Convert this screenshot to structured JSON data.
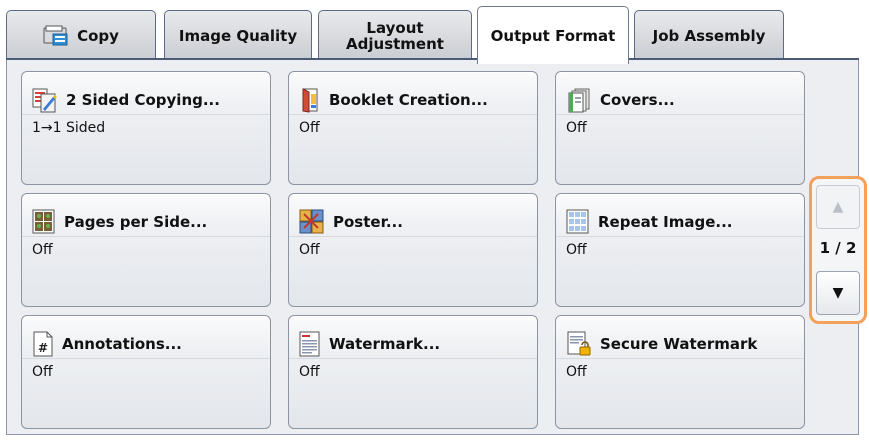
{
  "tabs": [
    {
      "label": "Copy",
      "icon": "copy-icon",
      "active": false
    },
    {
      "label": "Image Quality",
      "active": false
    },
    {
      "label": "Layout\nAdjustment",
      "active": false
    },
    {
      "label": "Output Format",
      "active": true
    },
    {
      "label": "Job Assembly",
      "active": false
    }
  ],
  "buttons": [
    {
      "title": "2 Sided Copying...",
      "value": "1→1 Sided",
      "icon": "two-sided-copying-icon"
    },
    {
      "title": "Booklet Creation...",
      "value": "Off",
      "icon": "booklet-icon"
    },
    {
      "title": "Covers...",
      "value": "Off",
      "icon": "covers-icon"
    },
    {
      "title": "Pages per Side...",
      "value": "Off",
      "icon": "pages-per-side-icon"
    },
    {
      "title": "Poster...",
      "value": "Off",
      "icon": "poster-icon"
    },
    {
      "title": "Repeat Image...",
      "value": "Off",
      "icon": "repeat-image-icon"
    },
    {
      "title": "Annotations...",
      "value": "Off",
      "icon": "annotations-icon"
    },
    {
      "title": "Watermark...",
      "value": "Off",
      "icon": "watermark-icon"
    },
    {
      "title": "Secure Watermark",
      "value": "Off",
      "icon": "secure-watermark-icon"
    }
  ],
  "pager": {
    "up_glyph": "▲",
    "down_glyph": "▼",
    "current_page": 1,
    "total_pages": 2,
    "page_text": "1 / 2"
  },
  "colors": {
    "tab_strip": "#4b5a76",
    "panel_bg": "#eceef2",
    "pager_highlight": "#f3a05b"
  }
}
